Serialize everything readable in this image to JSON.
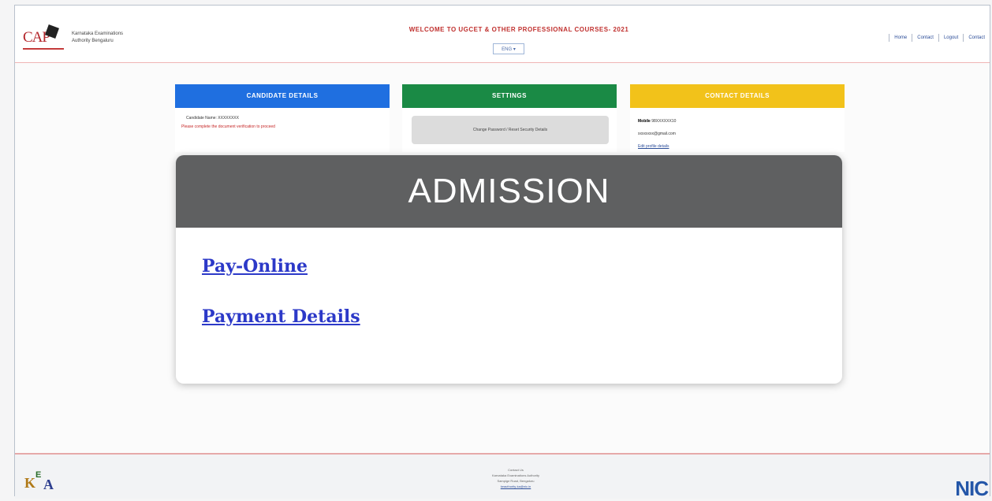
{
  "header": {
    "logo_text": "CAP",
    "org_line1": "Karnataka Examinations",
    "org_line2": "Authority Bengaluru",
    "welcome_text": "WELCOME TO UGCET & OTHER PROFESSIONAL COURSES- 2021",
    "language_select": "ENG ▾",
    "nav_links": [
      "Home",
      "Contact",
      "Logout",
      "Contact"
    ]
  },
  "cards": {
    "candidate": {
      "title": "CANDIDATE DETAILS",
      "line1": "Candidate Name: XXXXXXXX",
      "line2": "Please complete the document verification to proceed"
    },
    "settings": {
      "title": "SETTINGS",
      "inner": "Change Password / Reset Security Details"
    },
    "contact": {
      "title": "CONTACT DETAILS",
      "mobile_label": "Mobile",
      "mobile": "98XXXXXX10",
      "email": "xxxxxxxx@gmail.com",
      "link": "Edit profile details"
    }
  },
  "admission": {
    "title": "ADMISSION",
    "pay_online": "Pay-Online",
    "payment_details": "Payment Details"
  },
  "footer": {
    "line1": "Contact Us",
    "line2": "Karnataka Examinations Authority",
    "line3": "Sampige Road, Bengaluru",
    "line4": "keauthority-ka@nic.in",
    "kea_k": "K",
    "kea_e": "E",
    "kea_a": "A",
    "nic": "NIC"
  }
}
